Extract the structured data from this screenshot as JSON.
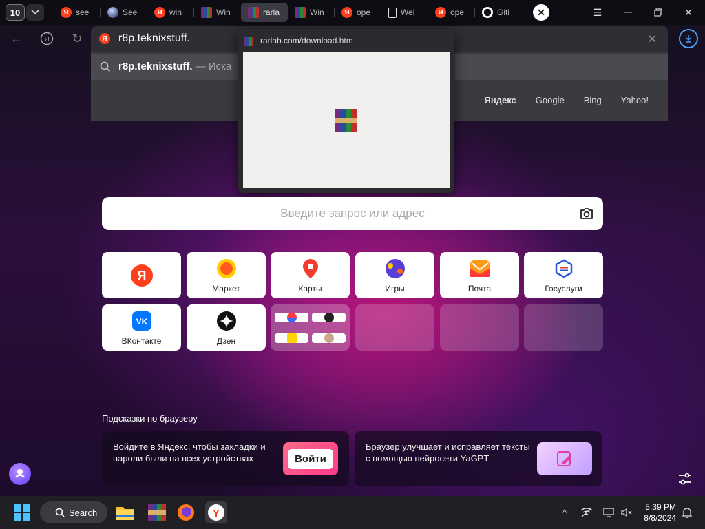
{
  "tabbar": {
    "tab_count": "10",
    "tabs": [
      {
        "label": "see",
        "favicon": "yandex-icon"
      },
      {
        "label": "See",
        "favicon": "sphere-icon"
      },
      {
        "label": "win",
        "favicon": "yandex-icon"
      },
      {
        "label": "Win",
        "favicon": "winrar-icon"
      },
      {
        "label": "rarla",
        "favicon": "winrar-icon",
        "active": true
      },
      {
        "label": "Win",
        "favicon": "winrar-icon"
      },
      {
        "label": "ope",
        "favicon": "yandex-icon"
      },
      {
        "label": "Wel",
        "favicon": "document-icon"
      },
      {
        "label": "ope",
        "favicon": "yandex-icon"
      },
      {
        "label": "Gitl",
        "favicon": "github-icon"
      }
    ]
  },
  "omnibox": {
    "value": "r8p.teknixstuff.",
    "suggestion_bold": "r8p.teknixstuff.",
    "suggestion_rest": " — Иска",
    "engines": [
      "Яндекс",
      "Google",
      "Bing",
      "Yahoo!"
    ]
  },
  "tab_preview": {
    "title": "rarlab.com/download.htm"
  },
  "main_search": {
    "placeholder": "Введите запрос или адрес"
  },
  "tiles": [
    {
      "label": "",
      "icon": "yandex-icon"
    },
    {
      "label": "Маркет",
      "icon": "market-icon"
    },
    {
      "label": "Карты",
      "icon": "maps-pin-icon"
    },
    {
      "label": "Игры",
      "icon": "games-icon"
    },
    {
      "label": "Почта",
      "icon": "mail-icon"
    },
    {
      "label": "Госуслуги",
      "icon": "gosuslugi-icon"
    },
    {
      "label": "ВКонтакте",
      "icon": "vk-icon"
    },
    {
      "label": "Дзен",
      "icon": "dzen-icon"
    }
  ],
  "hints": {
    "title": "Подсказки по браузеру",
    "card1_text": "Войдите в Яндекс, чтобы закладки и пароли были на всех устройствах",
    "card1_button": "Войти",
    "card2_text": "Браузер улучшает и исправляет тексты с помощью нейросети YaGPT"
  },
  "taskbar": {
    "search_label": "Search",
    "time": "5:39 PM",
    "date": "8/8/2024"
  },
  "colors": {
    "yandex_red": "#fc3f1d",
    "accent_blue": "#4aa3ff"
  }
}
